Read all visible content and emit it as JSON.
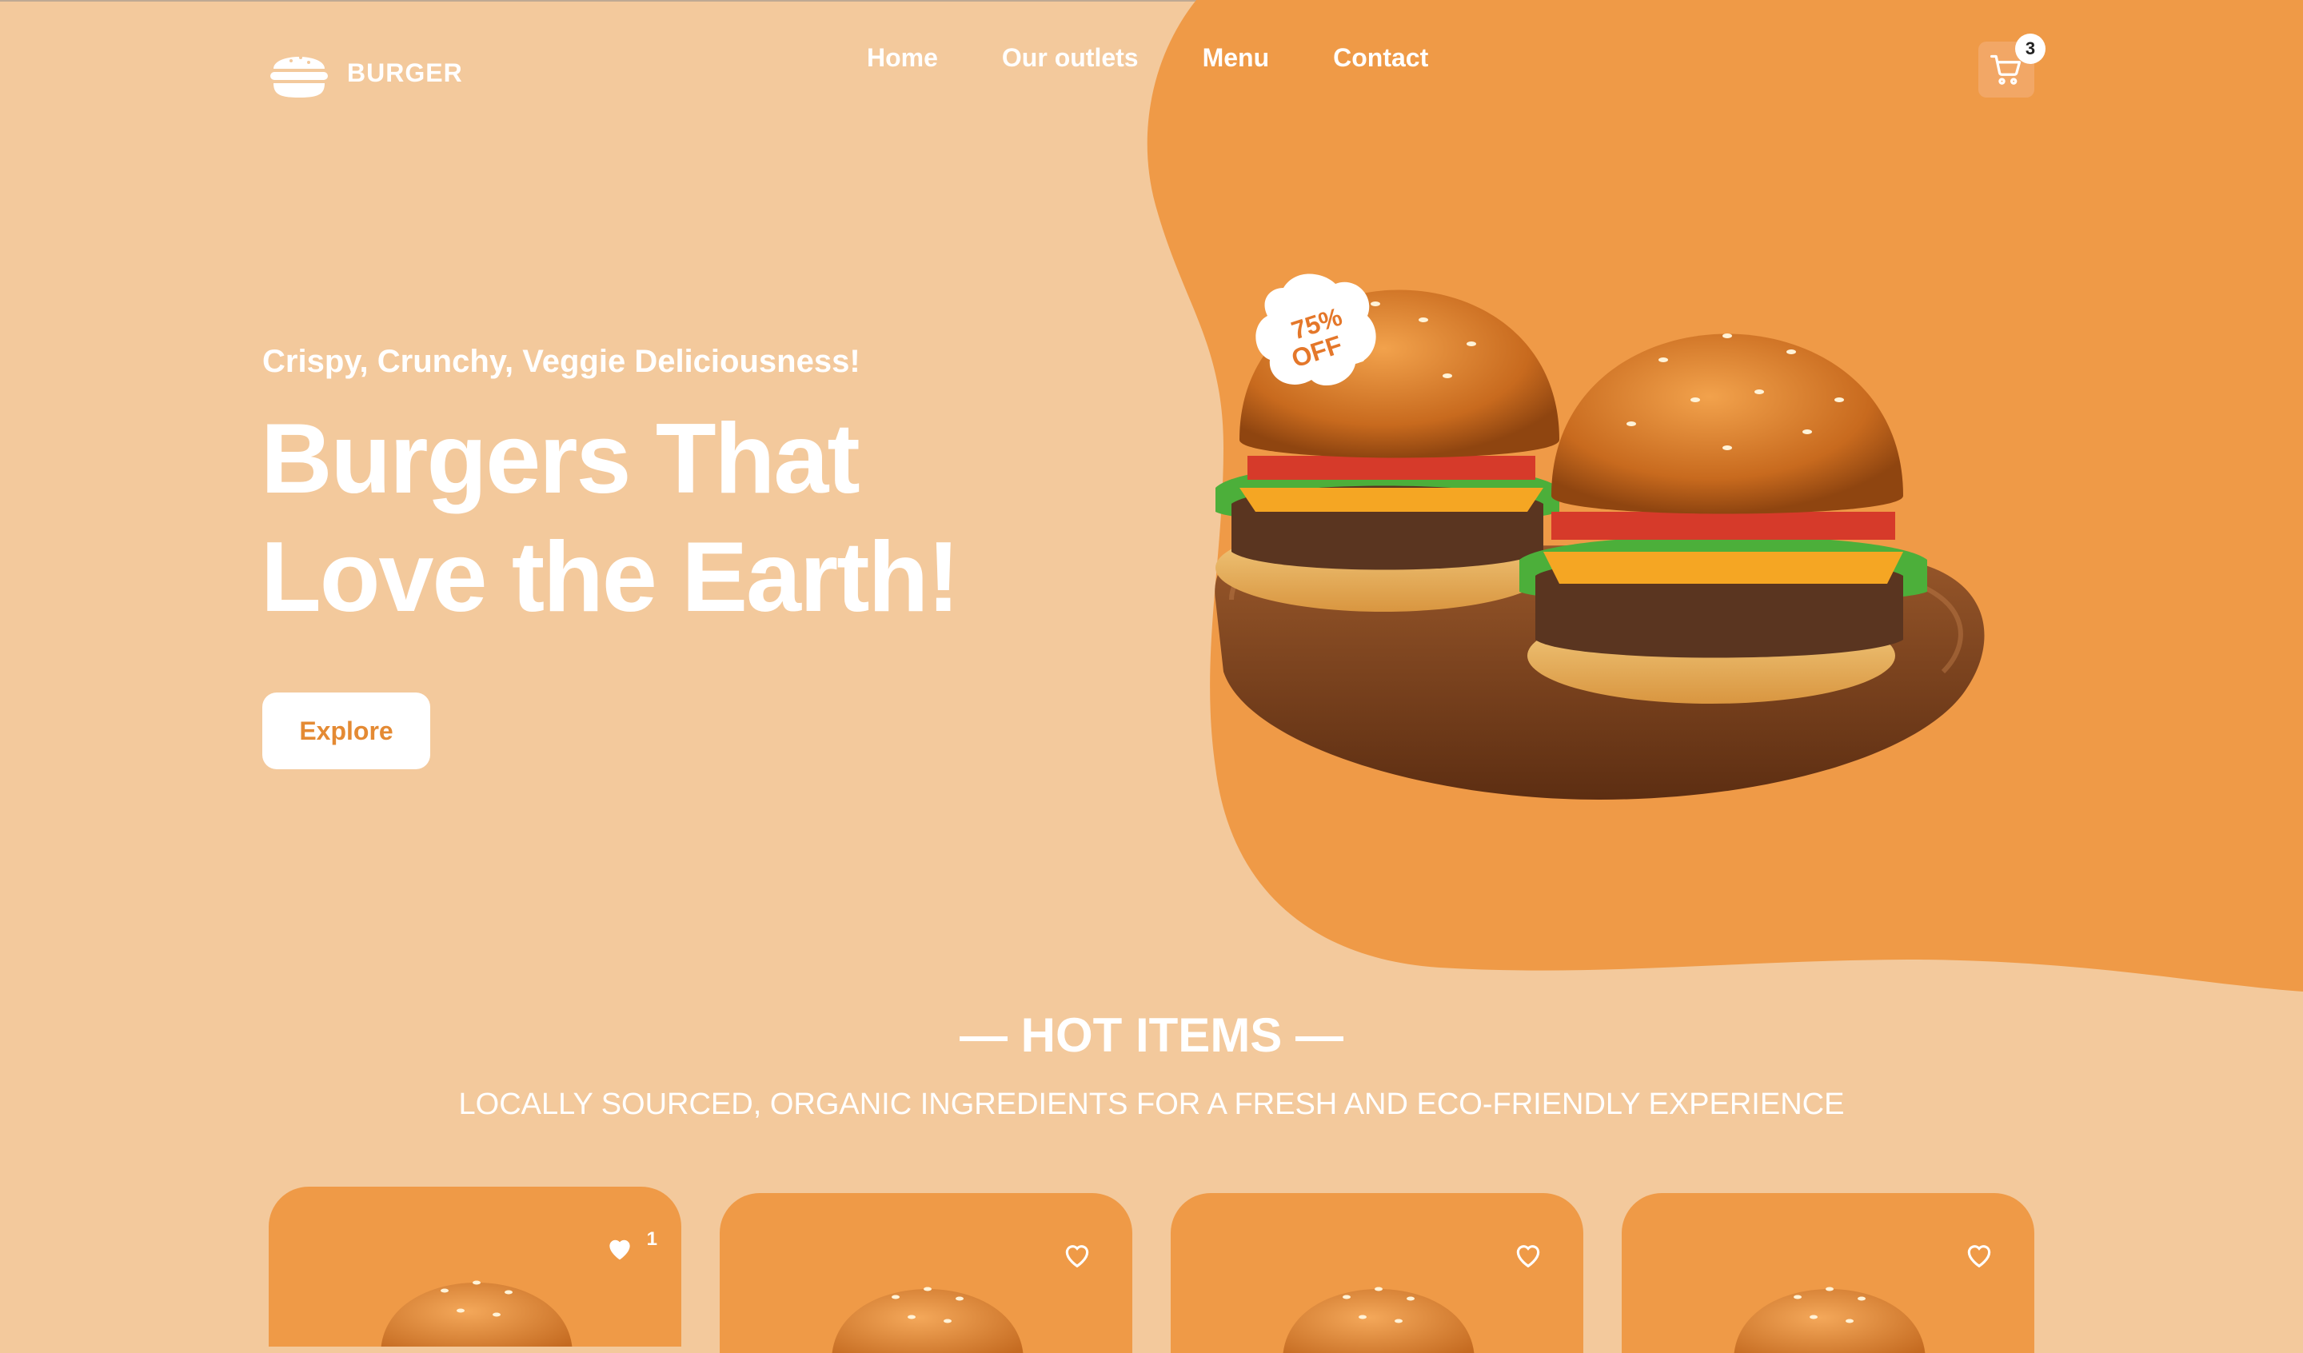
{
  "header": {
    "brand": "BURGER",
    "nav": [
      {
        "label": "Home"
      },
      {
        "label": "Our outlets"
      },
      {
        "label": "Menu"
      },
      {
        "label": "Contact"
      }
    ],
    "cart_count": "3"
  },
  "hero": {
    "tagline": "Crispy, Crunchy, Veggie Deliciousness!",
    "headline_line1": "Burgers That",
    "headline_line2": "Love the Earth!",
    "cta_label": "Explore",
    "badge_line1": "75%",
    "badge_line2": "OFF"
  },
  "hot_items": {
    "title": "— HOT ITEMS —",
    "subtitle": "LOCALLY SOURCED, ORGANIC INGREDIENTS FOR A FRESH AND ECO-FRIENDLY EXPERIENCE",
    "cards": [
      {
        "liked": true,
        "like_count": "1"
      },
      {
        "liked": false,
        "like_count": ""
      },
      {
        "liked": false,
        "like_count": ""
      },
      {
        "liked": false,
        "like_count": ""
      }
    ]
  },
  "colors": {
    "background": "#f3c99c",
    "accent": "#ef9a47",
    "accent_text": "#e48a33",
    "text": "#ffffff"
  },
  "icons": [
    "burger-logo-icon",
    "cart-icon",
    "heart-filled-icon",
    "heart-outline-icon"
  ]
}
